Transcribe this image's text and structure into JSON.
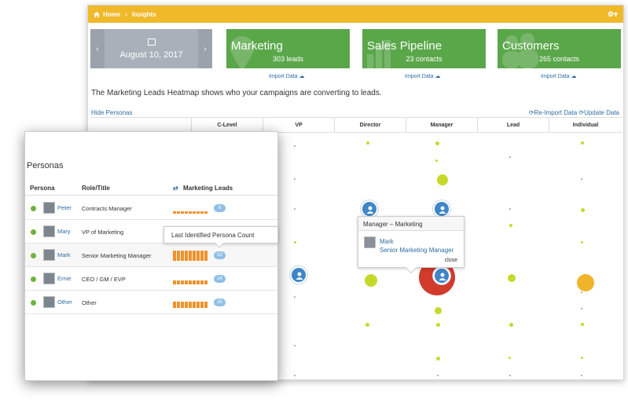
{
  "breadcrumb": {
    "home": "Home",
    "current": "Insights"
  },
  "date_card": {
    "date": "August 10, 2017",
    "prev": "‹",
    "next": "›"
  },
  "stats": [
    {
      "title": "Marketing",
      "sub": "303 leads",
      "import": "Import Data"
    },
    {
      "title": "Sales Pipeline",
      "sub": "23 contacts",
      "import": "Import Data"
    },
    {
      "title": "Customers",
      "sub": "265 contacts",
      "import": "Import Data"
    }
  ],
  "description": "The Marketing Leads Heatmap shows who your campaigns are converting to leads.",
  "hide_personas": "Hide Personas",
  "actions": {
    "reimport": "Re-Import Data",
    "update": "Update Data"
  },
  "heatmap_columns": [
    "C-Level",
    "VP",
    "Director",
    "Manager",
    "Lead",
    "Individual"
  ],
  "tooltip": {
    "header": "Manager – Marketing",
    "name": "Mark",
    "role": "Senior Marketing Manager",
    "close": "close"
  },
  "personas_panel": {
    "title": "Personas",
    "columns": {
      "persona": "Persona",
      "role": "Role/Title",
      "leads": "Marketing Leads"
    },
    "rows": [
      {
        "name": "Peter",
        "role": "Contracts Manager",
        "count": "6",
        "level": 0.25
      },
      {
        "name": "Mary",
        "role": "VP of Marketing",
        "count": "",
        "level": 0.3
      },
      {
        "name": "Mark",
        "role": "Senior Marketing Manager",
        "count": "52",
        "level": 1.0
      },
      {
        "name": "Ernie",
        "role": "CEO / GM / EVP",
        "count": "14",
        "level": 0.4
      },
      {
        "name": "Other",
        "role": "Other",
        "count": "26",
        "level": 0.6
      }
    ],
    "popover": "Last Identified Persona Count"
  },
  "colors": {
    "topbar": "#f0b92a",
    "card_green": "#5aa74a",
    "date_card": "#a8b1b9",
    "link": "#2e6da4",
    "dot_yellowgreen": "#c6d92a",
    "dot_red": "#d23a2a",
    "dot_orange": "#f0b42a",
    "pin_blue": "#3f86c8",
    "bar_orange": "#f0922a"
  }
}
